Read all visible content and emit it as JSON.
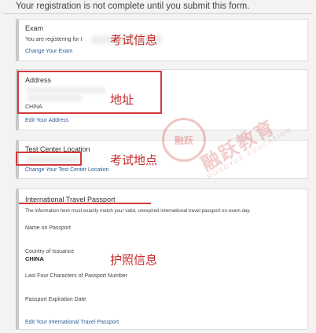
{
  "notice": "Your registration is not complete until you submit this form.",
  "exam": {
    "title": "Exam",
    "registering_text": "You are registering for t",
    "change_link": "Change Your Exam",
    "annotation": "考试信息"
  },
  "address": {
    "title": "Address",
    "country": "CHINA",
    "edit_link": "Edit Your Address",
    "annotation": "地址"
  },
  "test_center": {
    "title": "Test Center Location",
    "change_link": "Change Your Test Center Location",
    "annotation": "考试地点"
  },
  "passport": {
    "title": "International Travel Passport",
    "info": "The information here must exactly match your valid, unexpired international travel passport on exam day.",
    "name_label": "Name on Passport",
    "country_label": "Country of Issuance",
    "country_value": "CHINA",
    "last_four_label": "Last Four Characters of Passport Number",
    "expiration_label": "Passport Expiration Date",
    "edit_link": "Edit Your International Travel Passport",
    "annotation": "护照信息"
  },
  "watermark": {
    "seal_text": "融跃",
    "main_text": "融跃教育",
    "sub_text": "RONGYUE EDUCATION"
  },
  "colors": {
    "annotation_red": "#d23a3a",
    "link_blue": "#2a5d96",
    "card_border": "#dcdcdc"
  }
}
